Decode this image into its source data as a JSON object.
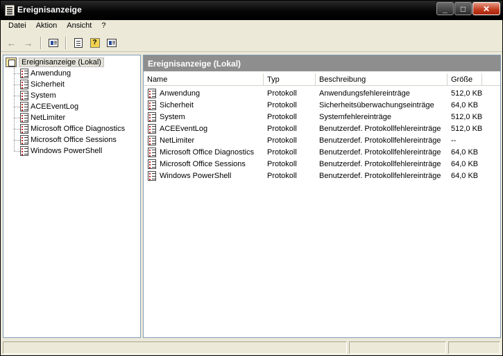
{
  "window": {
    "title": "Ereignisanzeige"
  },
  "title_buttons": {
    "minimize": "_",
    "maximize": "□",
    "close": "✕"
  },
  "menu": [
    "Datei",
    "Aktion",
    "Ansicht",
    "?"
  ],
  "toolbar": {
    "icons": [
      "back-arrow-icon",
      "forward-arrow-icon",
      "show-hide-tree-icon",
      "properties-icon",
      "help-icon",
      "show-hide-action-pane-icon"
    ]
  },
  "tree": {
    "root": "Ereignisanzeige (Lokal)",
    "items": [
      "Anwendung",
      "Sicherheit",
      "System",
      "ACEEventLog",
      "NetLimiter",
      "Microsoft Office Diagnostics",
      "Microsoft Office Sessions",
      "Windows PowerShell"
    ]
  },
  "right": {
    "header": "Ereignisanzeige (Lokal)",
    "columns": [
      "Name",
      "Typ",
      "Beschreibung",
      "Größe"
    ],
    "rows": [
      [
        "Anwendung",
        "Protokoll",
        "Anwendungsfehlereinträge",
        "512,0 KB"
      ],
      [
        "Sicherheit",
        "Protokoll",
        "Sicherheitsüberwachungseinträge",
        "64,0 KB"
      ],
      [
        "System",
        "Protokoll",
        "Systemfehlereinträge",
        "512,0 KB"
      ],
      [
        "ACEEventLog",
        "Protokoll",
        "Benutzerdef. Protokollfehlereinträge",
        "512,0 KB"
      ],
      [
        "NetLimiter",
        "Protokoll",
        "Benutzerdef. Protokollfehlereinträge",
        "--"
      ],
      [
        "Microsoft Office Diagnostics",
        "Protokoll",
        "Benutzerdef. Protokollfehlereinträge",
        "64,0 KB"
      ],
      [
        "Microsoft Office Sessions",
        "Protokoll",
        "Benutzerdef. Protokollfehlereinträge",
        "64,0 KB"
      ],
      [
        "Windows PowerShell",
        "Protokoll",
        "Benutzerdef. Protokollfehlereinträge",
        "64,0 KB"
      ]
    ]
  },
  "statusbar": [
    "",
    "",
    ""
  ]
}
